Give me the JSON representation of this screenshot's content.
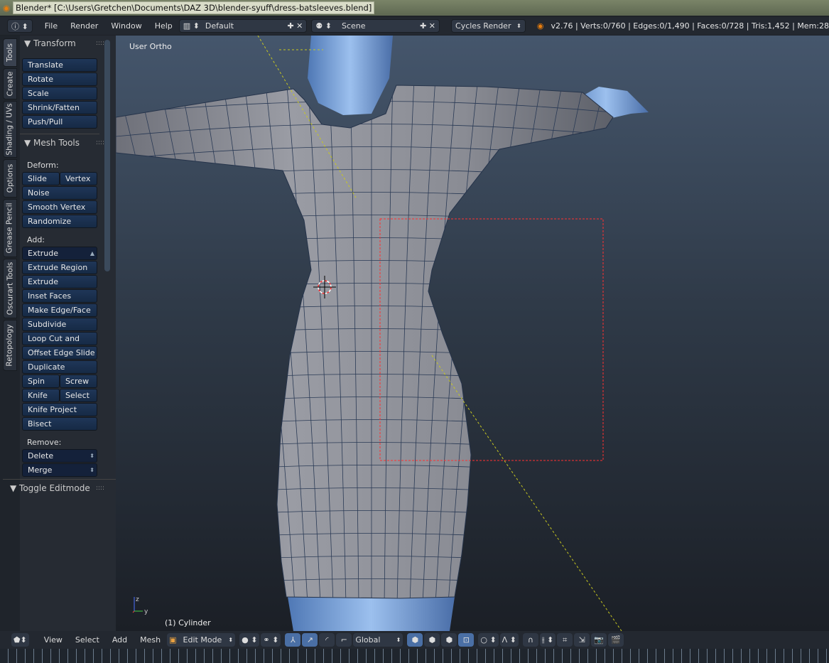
{
  "window": {
    "title": "Blender* [C:\\Users\\Gretchen\\Documents\\DAZ 3D\\blender-syuff\\dress-batsleeves.blend]"
  },
  "header": {
    "menus": [
      "File",
      "Render",
      "Window",
      "Help"
    ],
    "layout": "Default",
    "scene": "Scene",
    "engine": "Cycles Render",
    "stats": "v2.76 | Verts:0/760 | Edges:0/1,490 | Faces:0/728 | Tris:1,452 | Mem:28"
  },
  "tabs": [
    "Tools",
    "Create",
    "Shading / UVs",
    "Options",
    "Grease Pencil",
    "Oscurart Tools",
    "Retopology"
  ],
  "panel": {
    "transform_title": "Transform",
    "transform": [
      "Translate",
      "Rotate",
      "Scale",
      "Shrink/Fatten",
      "Push/Pull"
    ],
    "mesh_tools_title": "Mesh Tools",
    "deform_label": "Deform:",
    "slide_edge": "Slide Ed",
    "vertex": "Vertex",
    "deform": [
      "Noise",
      "Smooth Vertex",
      "Randomize"
    ],
    "add_label": "Add:",
    "extrude": "Extrude",
    "add": [
      "Extrude Region",
      "Extrude Individual",
      "Inset Faces",
      "Make Edge/Face",
      "Subdivide",
      "Loop Cut and Slide",
      "Offset Edge Slide",
      "Duplicate"
    ],
    "spin": "Spin",
    "screw": "Screw",
    "knife": "Knife",
    "select": "Select",
    "add2": [
      "Knife Project",
      "Bisect"
    ],
    "remove_label": "Remove:",
    "delete": "Delete",
    "merge": "Merge",
    "toggle_title": "Toggle Editmode"
  },
  "viewport": {
    "view_name": "User Ortho",
    "object": "(1) Cylinder",
    "axis_x": "x",
    "axis_y": "y",
    "axis_z": "z"
  },
  "bottom": {
    "menus": [
      "View",
      "Select",
      "Add",
      "Mesh"
    ],
    "mode": "Edit Mode",
    "orientation": "Global"
  },
  "colors": {
    "accent": "#4a6fa5",
    "mesh": "#8a8d96",
    "skin": "#6f9ad6",
    "selection_box": "#ff3030"
  }
}
